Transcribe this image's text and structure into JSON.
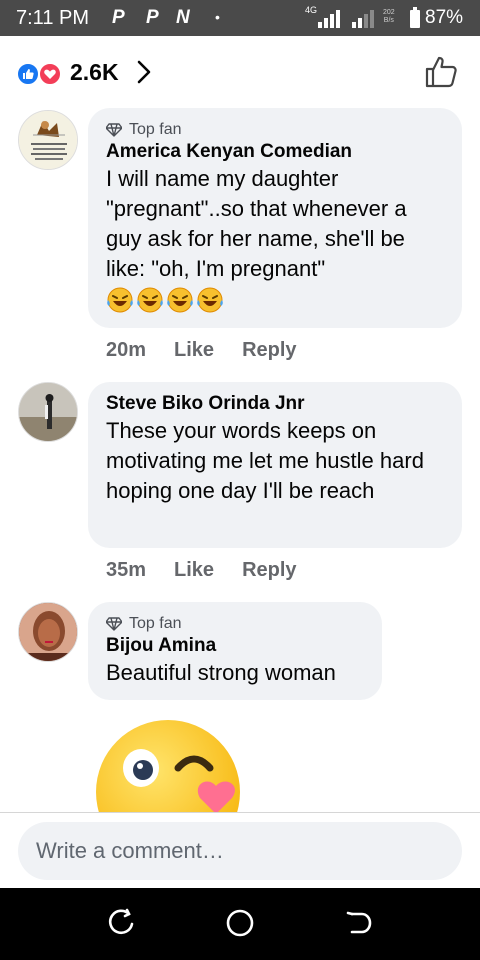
{
  "status_bar": {
    "time": "7:11 PM",
    "app_icons": [
      "P",
      "P",
      "N"
    ],
    "dot": "•",
    "network": "4G",
    "small_text_top": "202",
    "small_text_bottom": "B/s",
    "battery": "87%"
  },
  "header": {
    "reactions": [
      "like-icon",
      "love-icon"
    ],
    "reaction_count": "2.6K",
    "like_button_icon": "thumbs-up-icon"
  },
  "comments": [
    {
      "badge": "Top fan",
      "author": "America Kenyan Comedian",
      "text": "I will name my daughter \"pregnant\"..so that whenever a guy ask for her name, she'll be like: \"oh, I'm pregnant\"",
      "emoji_count": 4,
      "time": "20m",
      "like": "Like",
      "reply": "Reply"
    },
    {
      "badge": "",
      "author": "Steve Biko Orinda Jnr",
      "text": "These your words keeps on motivating me let me hustle hard hoping one day I'll be reach",
      "time": "35m",
      "like": "Like",
      "reply": "Reply"
    },
    {
      "badge": "Top fan",
      "author": "Bijou Amina",
      "text": "Beautiful strong woman"
    }
  ],
  "composer": {
    "placeholder": "Write a comment…"
  },
  "colors": {
    "facebook_blue": "#1877f2",
    "love_red": "#f33e58",
    "bubble_gray": "#f0f2f5",
    "meta_gray": "#65676b"
  }
}
